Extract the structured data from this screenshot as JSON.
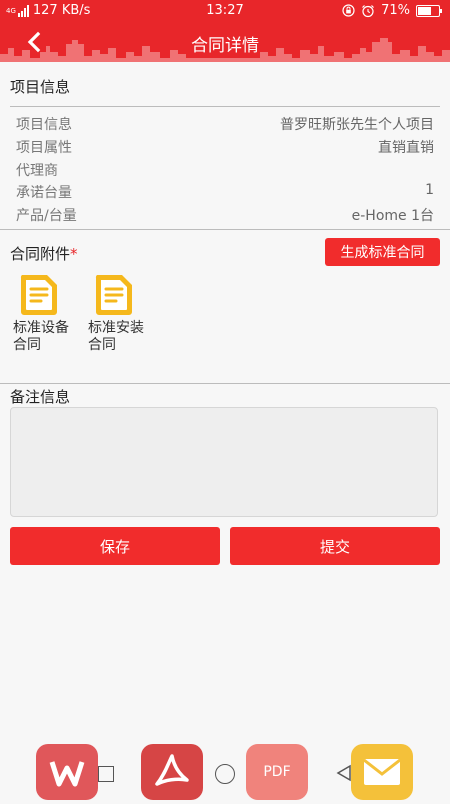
{
  "status_bar": {
    "network_speed": "127 KB/s",
    "network_type": "4G",
    "time": "13:27",
    "battery_percent": "71%",
    "battery_level": 0.71
  },
  "nav": {
    "title": "合同详情"
  },
  "project_info": {
    "section_title": "项目信息",
    "rows": [
      {
        "label": "项目信息",
        "value": "普罗旺斯张先生个人项目"
      },
      {
        "label": "项目属性",
        "value": "直销直销"
      },
      {
        "label": "代理商",
        "value": ""
      },
      {
        "label": "承诺台量",
        "value": "1"
      },
      {
        "label": "产品/台量",
        "value": "e-Home 1台"
      }
    ]
  },
  "attachments": {
    "section_title": "合同附件",
    "required_mark": "*",
    "generate_button_label": "生成标准合同",
    "files": [
      {
        "line1": "标准设备",
        "line2": "合同"
      },
      {
        "line1": "标准安装",
        "line2": "合同"
      }
    ]
  },
  "remarks": {
    "section_title": "备注信息",
    "value": "",
    "placeholder": ""
  },
  "actions": {
    "save_label": "保存",
    "submit_label": "提交"
  },
  "dock": {
    "apps": [
      {
        "name": "wps-app-icon",
        "color": "#e0575a"
      },
      {
        "name": "pdf-reader-app-icon",
        "color": "#d64545"
      },
      {
        "name": "pdf-app-icon",
        "label": "PDF",
        "color": "#f0837c"
      },
      {
        "name": "mail-app-icon",
        "color": "#f4c13a"
      }
    ]
  },
  "colors": {
    "brand_red": "#e8262a",
    "button_red": "#f12c2c",
    "doc_icon_yellow": "#f5b81c"
  }
}
